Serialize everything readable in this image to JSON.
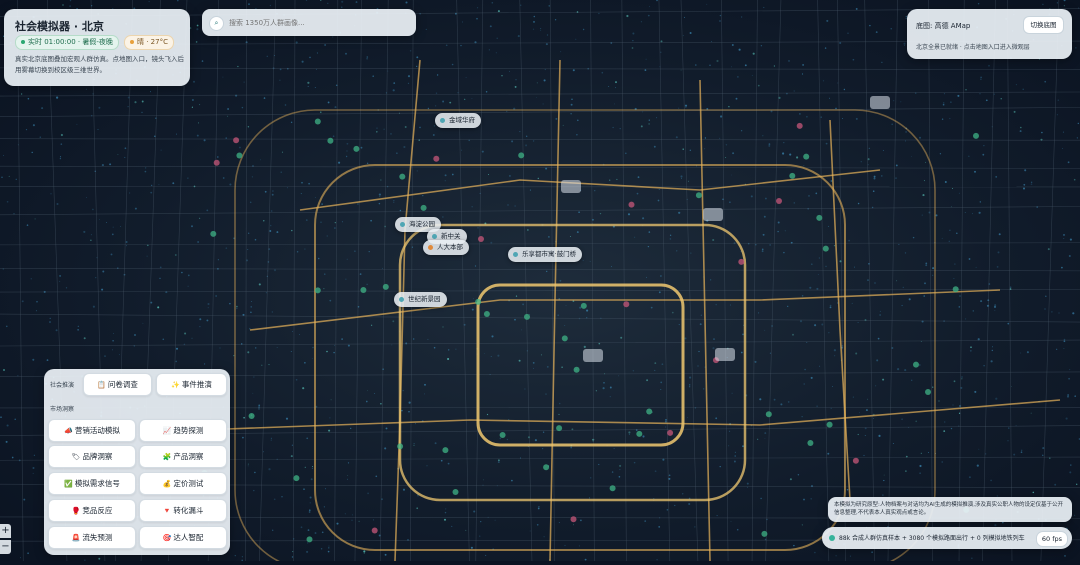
{
  "app": {
    "title": "社会模拟器 · 北京",
    "time_chip": "实时 01:00:00 · 暑假-夜晚",
    "weather_chip": "晴 · 27°C",
    "description": "真实北京底图叠加宏观人群仿真。点地图入口，镜头飞入后用雾幕切换到校区级三维世界。"
  },
  "search": {
    "placeholder": "搜索 1350万人群画像..."
  },
  "basemap": {
    "title": "底图: 高德 AMap",
    "switch_label": "切换底图",
    "description": "北京全景已就绪 · 点击地图入口进入微观层"
  },
  "market": {
    "section1": "社会推演",
    "section2": "市场洞察",
    "top_buttons": [
      {
        "icon": "📋",
        "label": "问卷调查"
      },
      {
        "icon": "✨",
        "label": "事件推演"
      }
    ],
    "grid_buttons": [
      {
        "icon": "📣",
        "label": "营销活动模拟"
      },
      {
        "icon": "📈",
        "label": "趋势探测"
      },
      {
        "icon": "🏷",
        "label": "品牌洞察"
      },
      {
        "icon": "🧩",
        "label": "产品洞察"
      },
      {
        "icon": "✅",
        "label": "模拟需求信号"
      },
      {
        "icon": "💰",
        "label": "定价测试"
      },
      {
        "icon": "🥊",
        "label": "竞品反应"
      },
      {
        "icon": "🔻",
        "label": "转化漏斗"
      },
      {
        "icon": "🚨",
        "label": "流失预测"
      },
      {
        "icon": "🎯",
        "label": "达人智配"
      }
    ]
  },
  "disclaimer": "本模拟为研究原型:人物档案与对话均为AI生成的模拟推演,涉及真实公职人物的设定仅基于公开信息整理,不代表本人真实观点或言论。",
  "status": {
    "text": "88k 合成人群仿真样本 + 3080 个模拟路面出行 + 0 列模拟地铁列车",
    "fps": "60 fps"
  },
  "zoom": {
    "in": "+",
    "out": "−"
  },
  "pois": [
    {
      "label": "金域华府"
    },
    {
      "label": "海淀公园"
    },
    {
      "label": "新中关"
    },
    {
      "label": "人大本部"
    },
    {
      "label": "乐享都市寓·鼓门桥"
    },
    {
      "label": "世纪新景园"
    }
  ],
  "colors": {
    "road": "#e8b45a",
    "ring": "#f0c870",
    "poi_dot": "#4fa6b4",
    "highlight": "#e08a3c"
  }
}
